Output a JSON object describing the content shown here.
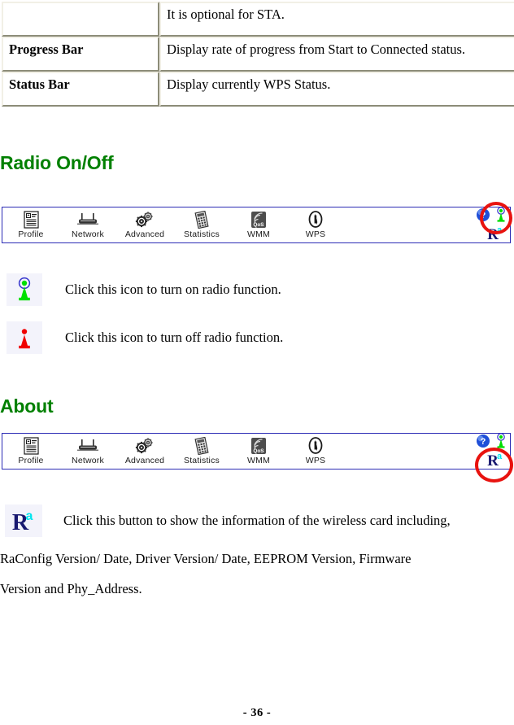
{
  "table": {
    "rows": [
      {
        "label": "",
        "desc": "It is optional for STA."
      },
      {
        "label": "Progress Bar",
        "desc": "Display rate of progress from Start to Connected status."
      },
      {
        "label": "Status Bar",
        "desc": "Display currently WPS Status."
      }
    ]
  },
  "sections": {
    "radio": {
      "heading": "Radio On/Off"
    },
    "about": {
      "heading": "About"
    }
  },
  "toolbar": {
    "items": [
      {
        "icon": "profile-icon",
        "label": "Profile"
      },
      {
        "icon": "network-icon",
        "label": "Network"
      },
      {
        "icon": "advanced-icon",
        "label": "Advanced"
      },
      {
        "icon": "statistics-icon",
        "label": "Statistics"
      },
      {
        "icon": "wmm-qos-icon",
        "label": "WMM"
      },
      {
        "icon": "wps-icon",
        "label": "WPS"
      }
    ],
    "help_icon": "help-question-icon",
    "radio_icon": "radio-on-icon",
    "about_icon": "ralink-about-icon",
    "about_icon_text": "R",
    "about_icon_superscript": "a"
  },
  "legend": {
    "radio_on": {
      "icon": "radio-on-icon",
      "text": "Click this icon to turn on radio function."
    },
    "radio_off": {
      "icon": "radio-off-icon",
      "text": "Click this icon to turn off radio function."
    }
  },
  "about": {
    "icon": "ralink-about-icon",
    "line1": "Click this button to show the information of the wireless card including,",
    "line2": "RaConfig Version/ Date, Driver Version/ Date, EEPROM Version, Firmware",
    "line3": "Version and Phy_Address."
  },
  "footer": {
    "page_number": "- 36 -"
  },
  "colors": {
    "heading_green": "#008000",
    "toolbar_border_blue": "#2b2bb5",
    "highlight_red": "#e8130f",
    "radio_on_green": "#00e000",
    "radio_off_red": "#f00000",
    "ralink_navy": "#191970",
    "ralink_cyan": "#00e5ee",
    "table_border": "#8c8c78"
  }
}
